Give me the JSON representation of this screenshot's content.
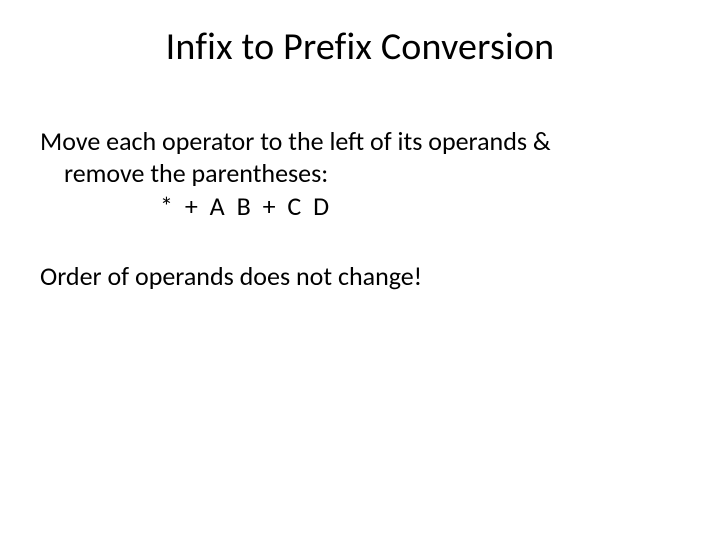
{
  "slide": {
    "title": "Infix to Prefix Conversion",
    "para1_line1": "Move each operator to the left of its operands &",
    "para1_line2": "remove the parentheses:",
    "expression": "* + A  B  + C   D",
    "para2": "Order of operands does not change!"
  }
}
